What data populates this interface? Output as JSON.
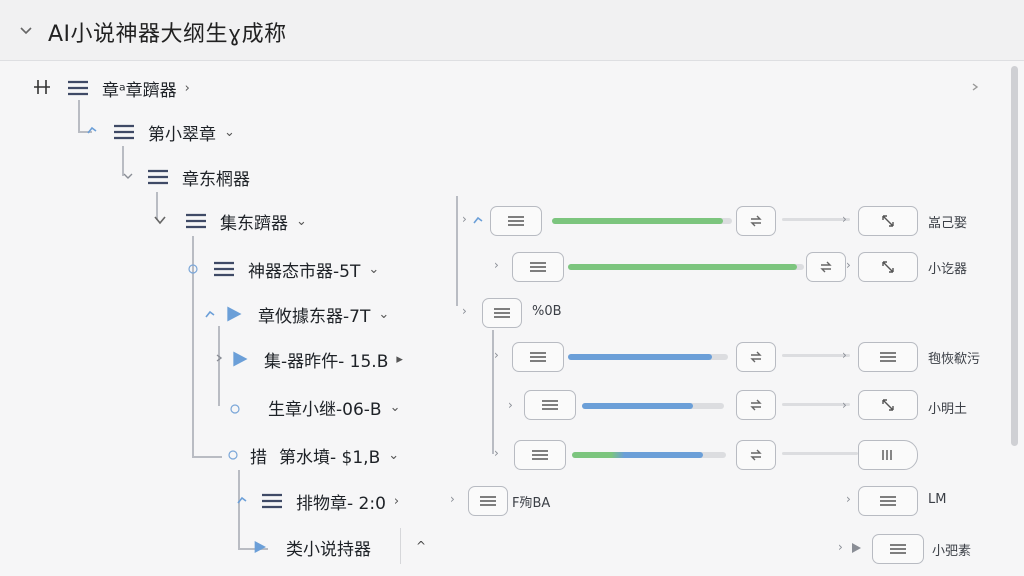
{
  "window": {
    "title": "AI小说神器大纲生ɣ成称"
  },
  "tree": [
    {
      "id": "n0",
      "label": "章ᵃ章躋器",
      "suffix": "›",
      "icon": "list-icon"
    },
    {
      "id": "n1",
      "label": "第小翠章",
      "suffix": "⌄",
      "icon": "list-icon"
    },
    {
      "id": "n2",
      "label": "章东棢器",
      "suffix": "",
      "icon": "list-icon"
    },
    {
      "id": "n3",
      "label": "集东躋器",
      "suffix": "⌄",
      "icon": "list-icon"
    },
    {
      "id": "n4",
      "label": "神器态市器-5T",
      "suffix": "⌄",
      "icon": "list-icon"
    },
    {
      "id": "n5",
      "label": "章攸據东器-7T",
      "suffix": "⌄",
      "icon": "play-icon"
    },
    {
      "id": "n6",
      "label": "集-器昨仵- 15.B",
      "suffix": "▸",
      "icon": "play-icon"
    },
    {
      "id": "n7",
      "label": "生章小继-06-B",
      "suffix": "⌄",
      "icon": "none"
    },
    {
      "id": "n8",
      "label": "第水墳- $1,B",
      "suffix": "⌄",
      "icon": "none",
      "prefix": "措"
    },
    {
      "id": "n9",
      "label": "排物章- 2:0",
      "suffix": "›",
      "icon": "list-icon"
    },
    {
      "id": "n10",
      "label": "类小说持器",
      "suffix": "^",
      "icon": "play-icon"
    }
  ],
  "flow": {
    "row1": {
      "progress": 0.95,
      "color": "#7cc57e",
      "tag": "嵓己娶"
    },
    "row2": {
      "progress": 0.97,
      "color": "#7cc57e",
      "tag": "小讫器"
    },
    "row3": {
      "tag": "%0B"
    },
    "row4": {
      "progress": 0.9,
      "color": "#6b9fd8",
      "tag": "毥恢欷污"
    },
    "row5": {
      "progress": 0.78,
      "color": "#6b9fd8",
      "tag": "小明土"
    },
    "row6": {
      "progress": 0.85,
      "color": "#6b9fd8",
      "tag": ""
    },
    "row7": {
      "left_tag": "F殉BA",
      "tag": "LM"
    },
    "row8": {
      "tag": "小弝素"
    }
  },
  "colors": {
    "accent_blue": "#6b9fd8",
    "accent_green": "#7cc57e",
    "tree_line": "#b9bcc3"
  },
  "icons": [
    "chevron-down-icon",
    "plus-icon",
    "list-icon",
    "play-icon",
    "expand-icon",
    "link-icon",
    "scrollbar"
  ]
}
